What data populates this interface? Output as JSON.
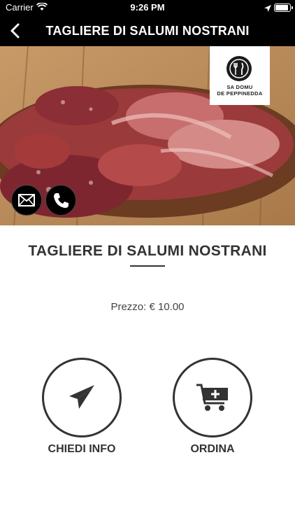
{
  "status_bar": {
    "carrier": "Carrier",
    "time": "9:26 PM"
  },
  "nav": {
    "title": "TAGLIERE DI SALUMI NOSTRANI"
  },
  "hero": {
    "logo_text_line1": "SA DOMU",
    "logo_text_line2": "DE PEPPINEDDA"
  },
  "product": {
    "title": "TAGLIERE DI SALUMI NOSTRANI",
    "price": "Prezzo: € 10.00"
  },
  "actions": {
    "info_label": "CHIEDI INFO",
    "order_label": "ORDINA"
  },
  "icons": [
    "chevron-left-icon",
    "wifi-icon",
    "location-icon",
    "battery-icon",
    "mail-icon",
    "phone-icon",
    "paper-plane-icon",
    "cart-add-icon",
    "fork-knife-icon"
  ],
  "colors": {
    "bar": "#000000",
    "text": "#333333",
    "price_text": "#444444"
  }
}
